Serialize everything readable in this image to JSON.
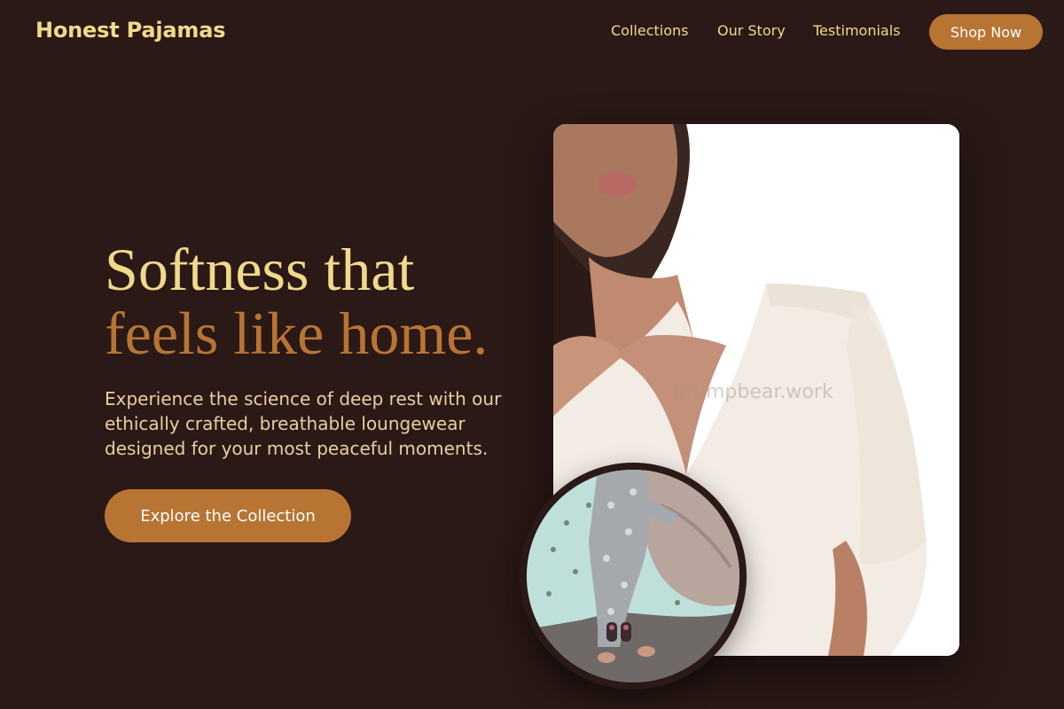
{
  "brand": {
    "name": "Honest Pajamas"
  },
  "nav": {
    "links": [
      "Collections",
      "Our Story",
      "Testimonials"
    ],
    "cta": "Shop Now"
  },
  "hero": {
    "headline_line1": "Softness that",
    "headline_line2": "feels like home.",
    "subtitle": "Experience the science of deep rest with our ethically crafted, breathable loungewear designed for your most peaceful moments.",
    "cta": "Explore the Collection"
  },
  "images": {
    "main_watermark": "grumpbear.work"
  },
  "colors": {
    "background": "#2a1916",
    "accent": "#b87433",
    "headline_primary": "#f0d98a",
    "text": "#e8cfa0"
  }
}
